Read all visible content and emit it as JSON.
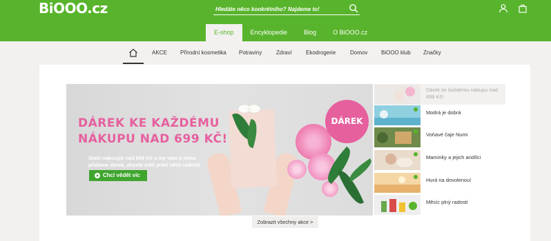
{
  "header": {
    "logo": "BiOOO.cz",
    "search": {
      "placeholder": "Hledáte něco konkrétního? Najdeme to!"
    },
    "icons": [
      "search-icon",
      "user-icon",
      "shopping-bag-icon"
    ],
    "tabs": [
      {
        "label": "E-shop",
        "active": true
      },
      {
        "label": "Encyklopedie",
        "active": false
      },
      {
        "label": "Blog",
        "active": false
      },
      {
        "label": "O BiOOO.cz",
        "active": false
      }
    ]
  },
  "catnav": {
    "home_icon": "home-icon",
    "items": [
      "AKCE",
      "Přírodní kosmetika",
      "Potraviny",
      "Zdraví",
      "Ekodrogerie",
      "Domov",
      "BiOOO klub",
      "Značky"
    ]
  },
  "banner": {
    "title": "Dárek ke každému nákupu nad 699 Kč!",
    "text": "Stačí nakoupit nad 699 Kč a my vám k tomu přidáme dárek, abyste měli ještě větší radost!",
    "cta": "Chci vědět víc",
    "badge": "DÁREK"
  },
  "promos": [
    {
      "label": "Dárek ke každému nákupu nad 699 Kč!",
      "active": true
    },
    {
      "label": "Modrá je dobrá",
      "active": false
    },
    {
      "label": "Voňavé čaje Numi",
      "active": false
    },
    {
      "label": "Maminky a jejich andílci",
      "active": false
    },
    {
      "label": "Hurá na dovolenou!",
      "active": false
    },
    {
      "label": "Měsíc plný radosti",
      "active": false
    }
  ],
  "show_all": "Zobrazit všechny akce >",
  "colors": {
    "brand_green": "#58b42c",
    "pink": "#e6609e",
    "cta_green": "#3fa52e"
  }
}
